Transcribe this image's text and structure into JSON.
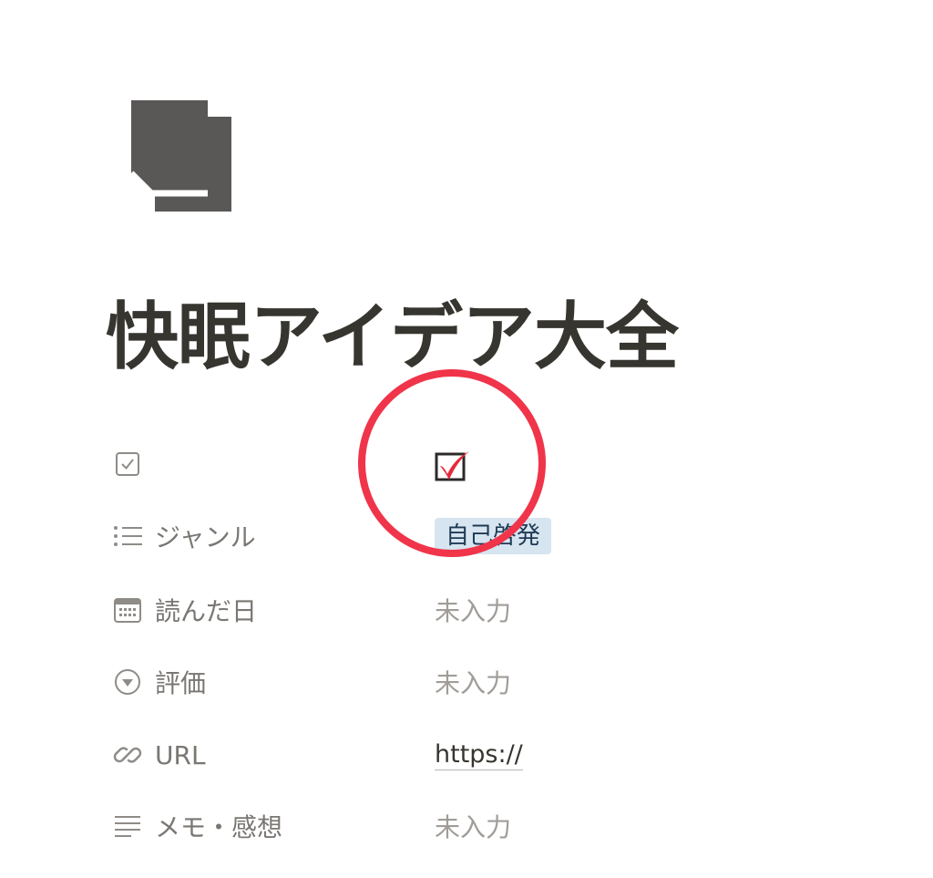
{
  "page": {
    "title": "快眠アイデア大全",
    "icon": "document-icon"
  },
  "properties": [
    {
      "name": "",
      "icon": "checkbox-property-icon",
      "type": "checkbox",
      "checked": true
    },
    {
      "name": "ジャンル",
      "icon": "list-icon",
      "type": "tag",
      "value": "自己啓発"
    },
    {
      "name": "読んだ日",
      "icon": "calendar-icon",
      "type": "date",
      "value": "未入力"
    },
    {
      "name": "評価",
      "icon": "select-icon",
      "type": "select",
      "value": "未入力"
    },
    {
      "name": "URL",
      "icon": "link-icon",
      "type": "url",
      "value": "https://"
    },
    {
      "name": "メモ・感想",
      "icon": "text-lines-icon",
      "type": "text",
      "value": "未入力"
    }
  ],
  "colors": {
    "title": "#37352f",
    "label": "#7a7773",
    "empty_value": "#a09d98",
    "tag_bg": "#d6e5f0",
    "highlight": "#f0344a"
  }
}
